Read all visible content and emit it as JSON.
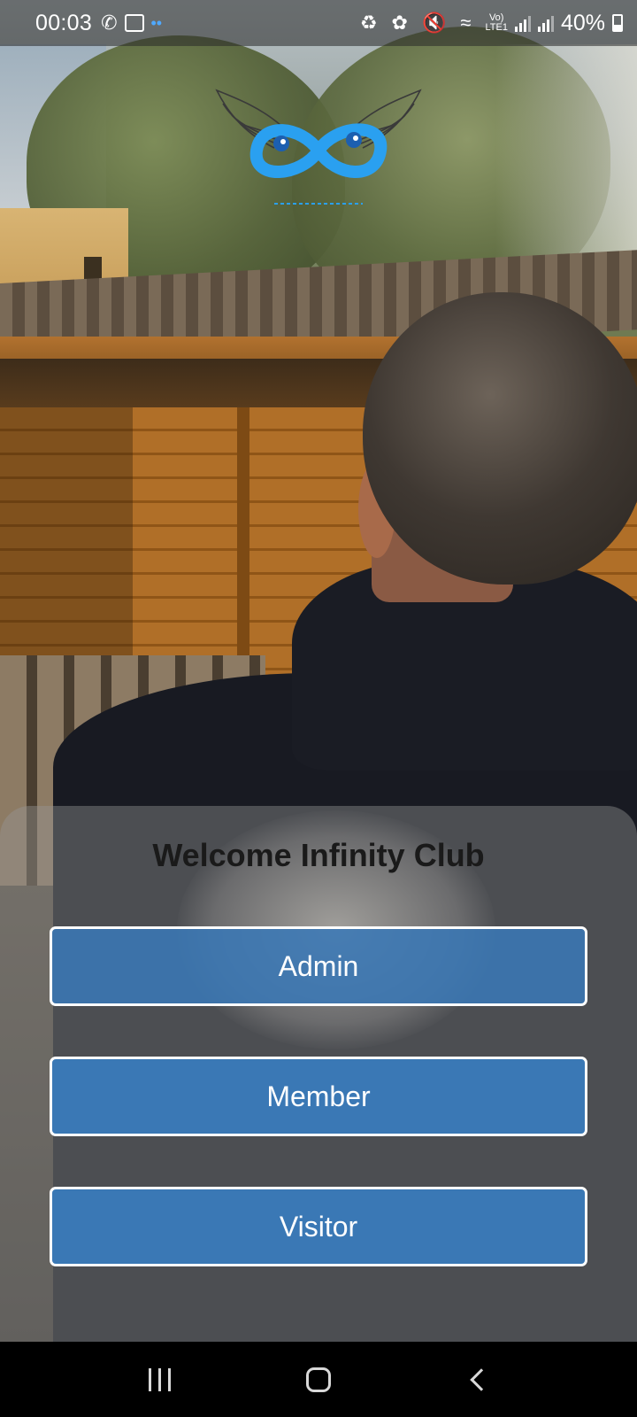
{
  "status_bar": {
    "time": "00:03",
    "battery_percent": "40%",
    "battery_level": 0.4,
    "network": "LTE1",
    "icons": [
      "whatsapp-icon",
      "gallery-icon",
      "notification-dot-icon",
      "data-saver-icon",
      "leaf-icon",
      "mute-icon",
      "wifi-icon",
      "volte-icon",
      "signal-icon",
      "signal-icon-2",
      "battery-icon"
    ]
  },
  "logo": {
    "name": "infinity-club-logo",
    "color": "#2aa0f0",
    "wing_color": "#3a3a3a"
  },
  "welcome": {
    "title": "Welcome Infinity Club"
  },
  "roles": {
    "admin_label": "Admin",
    "member_label": "Member",
    "visitor_label": "Visitor",
    "button_color": "#3a78b5",
    "button_border": "#ffffff"
  },
  "nav_bar": {
    "icons": [
      "recent-apps-icon",
      "home-icon",
      "back-icon"
    ]
  }
}
